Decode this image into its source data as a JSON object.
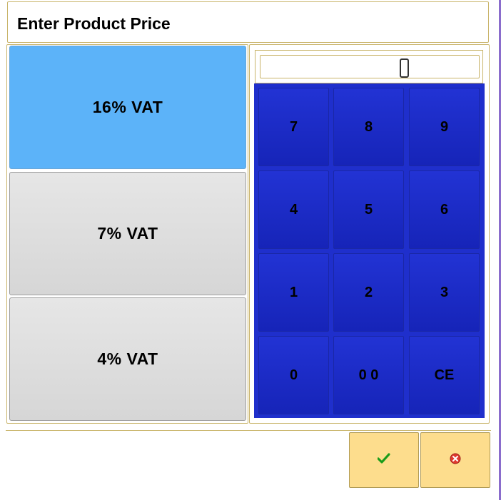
{
  "dialog": {
    "title": "Enter Product Price"
  },
  "vat_options": [
    {
      "label": "16% VAT",
      "selected": true
    },
    {
      "label": "7% VAT",
      "selected": false
    },
    {
      "label": "4% VAT",
      "selected": false
    }
  ],
  "price_display": {
    "value": "0"
  },
  "keypad": {
    "keys": [
      "7",
      "8",
      "9",
      "4",
      "5",
      "6",
      "1",
      "2",
      "3",
      "0",
      "0 0",
      "CE"
    ]
  },
  "actions": {
    "ok_icon": "checkmark-icon",
    "cancel_icon": "cancel-icon"
  },
  "colors": {
    "selected_vat": "#5cb3f9",
    "keypad_blue": "#1f2fcc",
    "action_yellow": "#fddd8d",
    "ok_green": "#21a51f",
    "cancel_red": "#e03a2f"
  }
}
